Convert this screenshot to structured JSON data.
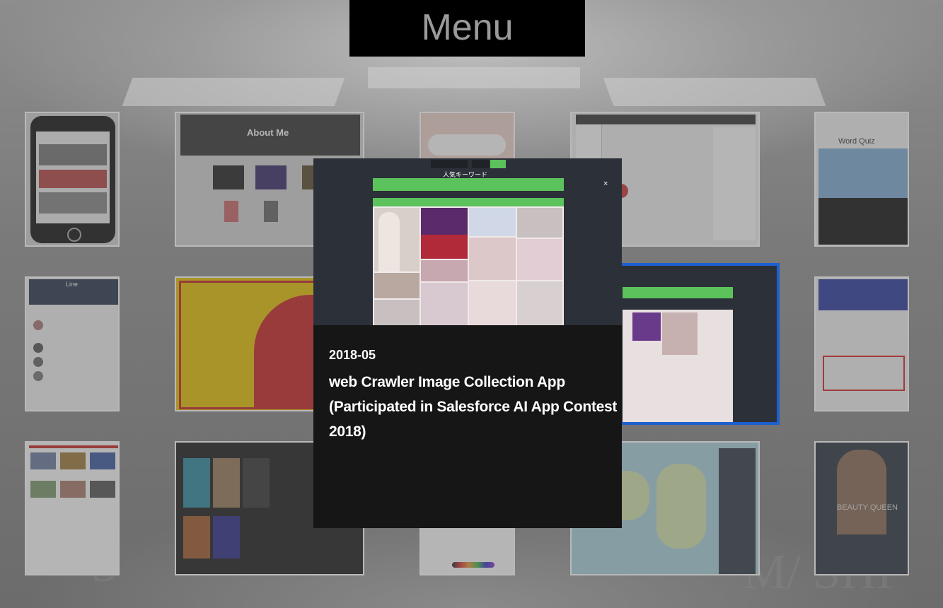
{
  "menu": {
    "title": "Menu"
  },
  "modal": {
    "date": "2018-05",
    "description": "web Crawler  Image Collection App (Participated in Salesforce AI App Contest 2018)",
    "screenshot": {
      "heading": "人気キーワード",
      "close_glyph": "×"
    }
  },
  "tiles": {
    "about_me": "About Me",
    "word_quiz": "Word Quiz",
    "line": "Line",
    "beauty_queen": "BEAUTY QUEEN"
  },
  "colors": {
    "menu_bg": "#000000",
    "selected_border": "#1d5fcf",
    "modal_bg": "#161616",
    "accent_green": "#5cc25c"
  }
}
